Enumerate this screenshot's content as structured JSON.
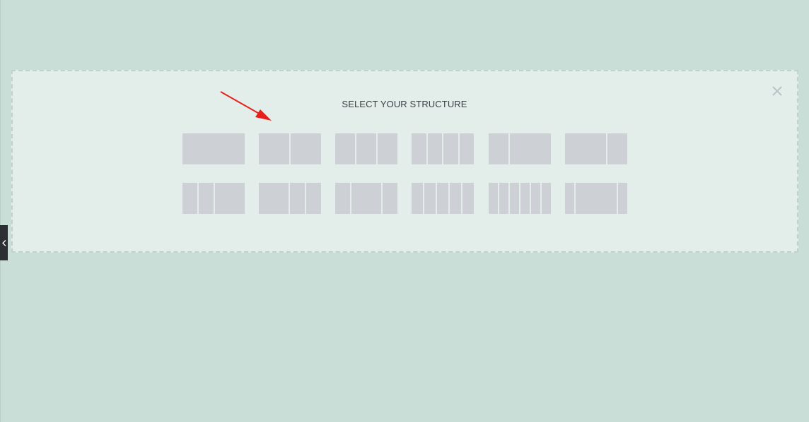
{
  "heading": "SELECT YOUR STRUCTURE",
  "colors": {
    "background": "#c9ded6",
    "box": "#e3edea",
    "box_border": "#bfd2cb",
    "column": "#cdd1d6",
    "close": "#b9c2c7",
    "toggle": "#2b2f33",
    "arrow": "#e8201c"
  },
  "icons": {
    "close": "close-icon",
    "toggle": "chevron-left-icon"
  },
  "presets": [
    {
      "name": "one-column",
      "cols": [
        100
      ]
    },
    {
      "name": "two-equal",
      "cols": [
        50,
        50
      ]
    },
    {
      "name": "three-equal",
      "cols": [
        33,
        33,
        33
      ]
    },
    {
      "name": "four-equal",
      "cols": [
        25,
        25,
        25,
        25
      ]
    },
    {
      "name": "one-third-two-thirds",
      "cols": [
        33,
        67
      ]
    },
    {
      "name": "two-thirds-one-third",
      "cols": [
        67,
        33
      ]
    },
    {
      "name": "quarter-quarter-half",
      "cols": [
        25,
        25,
        50
      ]
    },
    {
      "name": "half-quarter-quarter",
      "cols": [
        50,
        25,
        25
      ]
    },
    {
      "name": "quarter-half-quarter",
      "cols": [
        25,
        50,
        25
      ]
    },
    {
      "name": "five-equal",
      "cols": [
        20,
        20,
        20,
        20,
        20
      ]
    },
    {
      "name": "six-equal",
      "cols": [
        16,
        16,
        16,
        16,
        16,
        16
      ]
    },
    {
      "name": "sixth-two-thirds-sixth",
      "cols": [
        16,
        68,
        16
      ]
    }
  ]
}
